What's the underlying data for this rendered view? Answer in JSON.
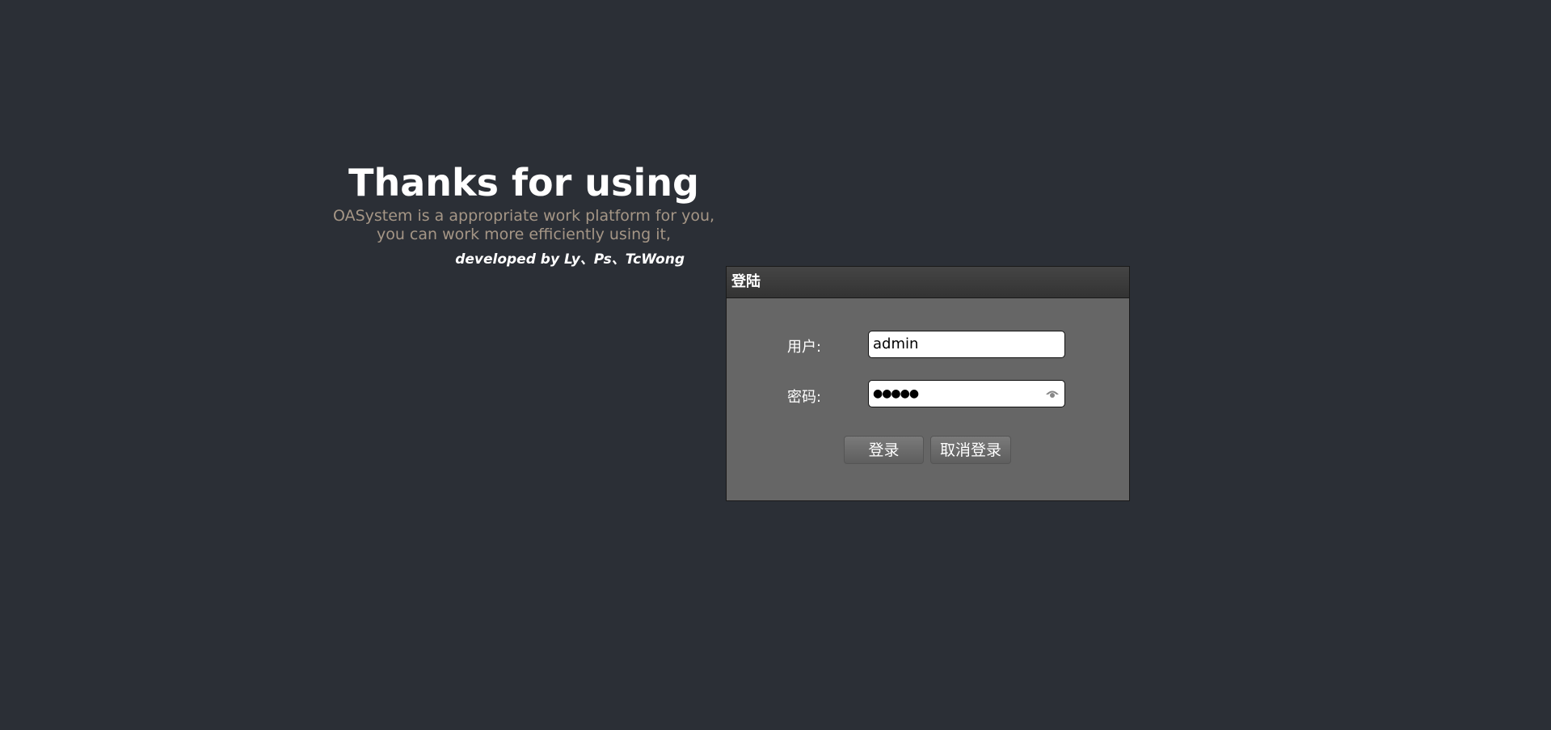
{
  "intro": {
    "title": "Thanks for using",
    "line1": "OASystem is a appropriate work platform for you,",
    "line2": "you can work more efficiently using it,",
    "developers": "developed by Ly、Ps、TcWong"
  },
  "login": {
    "title": "登陆",
    "user_label": "用户:",
    "user_value": "admin",
    "password_label": "密码:",
    "password_value": "●●●●●",
    "login_button": "登录",
    "cancel_button": "取消登录"
  }
}
